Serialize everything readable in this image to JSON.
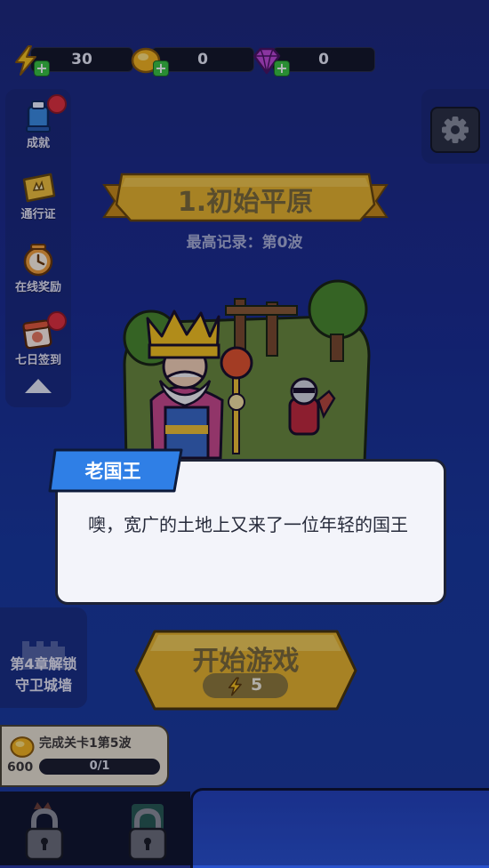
{
  "resources": {
    "energy": {
      "icon": "lightning-icon",
      "value": "30"
    },
    "gold": {
      "icon": "gold-coin-icon",
      "value": "0"
    },
    "gem": {
      "icon": "gem-icon",
      "value": "0"
    }
  },
  "sidebar": {
    "items": [
      {
        "label": "成就",
        "icon": "trophy-icon",
        "badge": true
      },
      {
        "label": "通行证",
        "icon": "ticket-icon",
        "badge": false
      },
      {
        "label": "在线奖励",
        "icon": "clock-icon",
        "badge": false
      },
      {
        "label": "七日签到",
        "icon": "calendar-icon",
        "badge": true
      }
    ]
  },
  "level": {
    "title": "1.初始平原",
    "best_record": "最高记录：第0波"
  },
  "dialog": {
    "speaker": "老国王",
    "text": "噢，宽广的土地上又来了一位年轻的国王"
  },
  "chapter_unlock": {
    "line1": "第4章解锁",
    "line2": "守卫城墙"
  },
  "start_button": {
    "label": "开始游戏",
    "cost": "5"
  },
  "quest": {
    "title": "完成关卡1第5波",
    "reward": "600",
    "progress": "0/1"
  },
  "colors": {
    "background": "#1b2d8e",
    "banner_gold": "#e8b52a",
    "dialog_tag_blue": "#2f7fe6",
    "badge_red": "#e1313b",
    "plus_green": "#39c43f"
  }
}
